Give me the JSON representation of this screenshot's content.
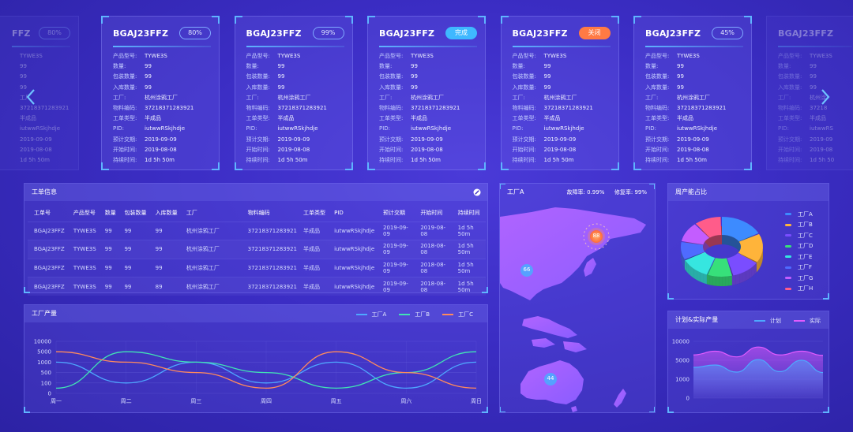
{
  "cards": [
    {
      "title": "BGAJ23FFZ",
      "badge": "80%",
      "badge_type": "outline",
      "rows": [
        [
          "产品型号:",
          "TYWE3S"
        ],
        [
          "数量:",
          "99"
        ],
        [
          "包装数量:",
          "99"
        ],
        [
          "入库数量:",
          "99"
        ],
        [
          "工厂:",
          "杭州涂鸦工厂"
        ],
        [
          "物料编码:",
          "37218371283921"
        ],
        [
          "工单类型:",
          "半成品"
        ],
        [
          "PID:",
          "iutwwRSkjhdje"
        ],
        [
          "预计交期:",
          "2019-09-09"
        ],
        [
          "开始时间:",
          "2019-08-08"
        ],
        [
          "持续时间:",
          "1d 5h 50m"
        ]
      ]
    },
    {
      "title": "BGAJ23FFZ",
      "badge": "99%",
      "badge_type": "outline",
      "rows": [
        [
          "产品型号:",
          "TYWE3S"
        ],
        [
          "数量:",
          "99"
        ],
        [
          "包装数量:",
          "99"
        ],
        [
          "入库数量:",
          "99"
        ],
        [
          "工厂:",
          "杭州涂鸦工厂"
        ],
        [
          "物料编码:",
          "37218371283921"
        ],
        [
          "工单类型:",
          "半成品"
        ],
        [
          "PID:",
          "iutwwRSkjhdje"
        ],
        [
          "预计交期:",
          "2019-09-09"
        ],
        [
          "开始时间:",
          "2019-08-08"
        ],
        [
          "持续时间:",
          "1d 5h 50m"
        ]
      ]
    },
    {
      "title": "BGAJ23FFZ",
      "badge": "完成",
      "badge_type": "done",
      "rows": [
        [
          "产品型号:",
          "TYWE3S"
        ],
        [
          "数量:",
          "99"
        ],
        [
          "包装数量:",
          "99"
        ],
        [
          "入库数量:",
          "99"
        ],
        [
          "工厂:",
          "杭州涂鸦工厂"
        ],
        [
          "物料编码:",
          "37218371283921"
        ],
        [
          "工单类型:",
          "半成品"
        ],
        [
          "PID:",
          "iutwwRSkjhdje"
        ],
        [
          "预计交期:",
          "2019-09-09"
        ],
        [
          "开始时间:",
          "2019-08-08"
        ],
        [
          "持续时间:",
          "1d 5h 50m"
        ]
      ]
    },
    {
      "title": "BGAJ23FFZ",
      "badge": "关闭",
      "badge_type": "closed",
      "rows": [
        [
          "产品型号:",
          "TYWE3S"
        ],
        [
          "数量:",
          "99"
        ],
        [
          "包装数量:",
          "99"
        ],
        [
          "入库数量:",
          "99"
        ],
        [
          "工厂:",
          "杭州涂鸦工厂"
        ],
        [
          "物料编码:",
          "37218371283921"
        ],
        [
          "工单类型:",
          "半成品"
        ],
        [
          "PID:",
          "iutwwRSkjhdje"
        ],
        [
          "预计交期:",
          "2019-09-09"
        ],
        [
          "开始时间:",
          "2019-08-08"
        ],
        [
          "持续时间:",
          "1d 5h 50m"
        ]
      ]
    },
    {
      "title": "BGAJ23FFZ",
      "badge": "45%",
      "badge_type": "outline",
      "rows": [
        [
          "产品型号:",
          "TYWE3S"
        ],
        [
          "数量:",
          "99"
        ],
        [
          "包装数量:",
          "99"
        ],
        [
          "入库数量:",
          "99"
        ],
        [
          "工厂:",
          "杭州涂鸦工厂"
        ],
        [
          "物料编码:",
          "37218371283921"
        ],
        [
          "工单类型:",
          "半成品"
        ],
        [
          "PID:",
          "iutwwRSkjhdje"
        ],
        [
          "预计交期:",
          "2019-09-09"
        ],
        [
          "开始时间:",
          "2019-08-08"
        ],
        [
          "持续时间:",
          "1d 5h 50m"
        ]
      ]
    }
  ],
  "left_partial_card": {
    "title": "FFZ",
    "badge": "80%",
    "rows": [
      "TYWE3S",
      "99",
      "99",
      "99",
      "工厂",
      "37218371283921",
      "半成品",
      "iutwwRSkjhdje",
      "2019-09-09",
      "2019-08-08",
      "1d 5h 50m"
    ]
  },
  "right_partial_card": {
    "title": "BGAJ23FFZ",
    "rows": [
      [
        "产品型号:",
        "TYWE3S"
      ],
      [
        "数量:",
        "99"
      ],
      [
        "包装数量:",
        "99"
      ],
      [
        "入库数量:",
        "99"
      ],
      [
        "工厂:",
        "杭州涂"
      ],
      [
        "物料编码:",
        "37218"
      ],
      [
        "工单类型:",
        "半成品"
      ],
      [
        "PID:",
        "iutwwRS"
      ],
      [
        "预计交期:",
        "2019-09"
      ],
      [
        "开始时间:",
        "2019-08"
      ],
      [
        "持续时间:",
        "1d 5h 50"
      ]
    ]
  },
  "orders_panel": {
    "title": "工单信息",
    "columns": [
      "工单号",
      "产品型号",
      "数量",
      "包装数量",
      "入库数量",
      "工厂",
      "物料编码",
      "工单类型",
      "PID",
      "预计交期",
      "开始时间",
      "持续时间"
    ],
    "rows": [
      [
        "BGAJ23FFZ",
        "TYWE3S",
        "99",
        "99",
        "99",
        "杭州涂鸦工厂",
        "37218371283921",
        "半成品",
        "iutwwRSkjhdje",
        "2019-09-09",
        "2019-08-08",
        "1d 5h 50m"
      ],
      [
        "BGAJ23FFZ",
        "TYWE3S",
        "99",
        "99",
        "99",
        "杭州涂鸦工厂",
        "37218371283921",
        "半成品",
        "iutwwRSkjhdje",
        "2019-09-09",
        "2018-08-08",
        "1d 5h 50m"
      ],
      [
        "BGAJ23FFZ",
        "TYWE3S",
        "99",
        "99",
        "99",
        "杭州涂鸦工厂",
        "37218371283921",
        "半成品",
        "iutwwRSkjhdje",
        "2019-09-09",
        "2018-08-08",
        "1d 5h 50m"
      ],
      [
        "BGAJ23FFZ",
        "TYWE3S",
        "99",
        "99",
        "89",
        "杭州涂鸦工厂",
        "37218371283921",
        "半成品",
        "iutwwRSkjhdje",
        "2019-09-09",
        "2018-08-08",
        "1d 5h 50m"
      ]
    ]
  },
  "map_panel": {
    "title": "工厂A",
    "failure_label": "故障率:",
    "failure_value": "0.99%",
    "repair_label": "修复率:",
    "repair_value": "99%",
    "markers": [
      {
        "label": "88",
        "emphasis": true
      },
      {
        "label": "66"
      },
      {
        "label": "44"
      }
    ]
  },
  "share_panel": {
    "title": "周产能占比"
  },
  "chart_data": [
    {
      "type": "line",
      "title": "工厂产量",
      "categories": [
        "周一",
        "周二",
        "周三",
        "周四",
        "周五",
        "周六",
        "周日"
      ],
      "yticks": [
        "0",
        "100",
        "500",
        "1000",
        "5000",
        "10000"
      ],
      "series": [
        {
          "name": "工厂A",
          "color": "#4ea8ff",
          "values": [
            1000,
            100,
            1000,
            100,
            1000,
            50,
            1000
          ]
        },
        {
          "name": "工厂B",
          "color": "#41e3b5",
          "values": [
            50,
            5000,
            1000,
            500,
            50,
            500,
            5000
          ]
        },
        {
          "name": "工厂C",
          "color": "#ff8a5c",
          "values": [
            5000,
            1000,
            500,
            50,
            5000,
            500,
            50
          ]
        }
      ]
    },
    {
      "type": "pie",
      "title": "周产能占比",
      "slices": [
        {
          "name": "工厂A",
          "color": "#3d8bff",
          "value": 18
        },
        {
          "name": "工厂B",
          "color": "#ffb43a",
          "value": 16
        },
        {
          "name": "工厂C",
          "color": "#7a4dff",
          "value": 12
        },
        {
          "name": "工厂D",
          "color": "#37e07a",
          "value": 10
        },
        {
          "name": "工厂E",
          "color": "#36e6e0",
          "value": 12
        },
        {
          "name": "工厂F",
          "color": "#4f6bff",
          "value": 10
        },
        {
          "name": "工厂G",
          "color": "#c35dff",
          "value": 11
        },
        {
          "name": "工厂H",
          "color": "#ff5c8a",
          "value": 11
        }
      ]
    },
    {
      "type": "area",
      "title": "计划&实际产量",
      "yticks": [
        "0",
        "1000",
        "5000",
        "10000"
      ],
      "series": [
        {
          "name": "计划",
          "color": "#4ea8ff",
          "values": [
            3500,
            4000,
            2500,
            5200,
            2600,
            5000,
            2400
          ]
        },
        {
          "name": "实际",
          "color": "#e25bff",
          "values": [
            6400,
            7400,
            5900,
            8500,
            6400,
            7400,
            6300
          ]
        }
      ]
    }
  ]
}
